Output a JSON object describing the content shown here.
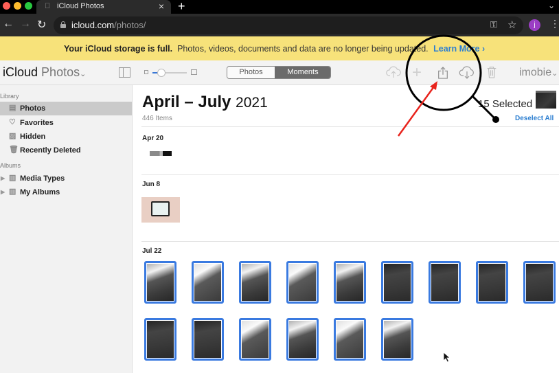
{
  "browser": {
    "tab_title": "iCloud Photos",
    "new_tab_label": "+",
    "url_host": "icloud.com",
    "url_path": "/photos/",
    "profile_initial": "j"
  },
  "banner": {
    "bold_text": "Your iCloud storage is full.",
    "text": "Photos, videos, documents and data are no longer being updated.",
    "link_label": "Learn More",
    "link_chevron": "›"
  },
  "toolbar": {
    "app_name": "iCloud",
    "app_section": "Photos",
    "app_chevron": "⌄",
    "zoom_level": 0.25,
    "segments": [
      "Photos",
      "Moments"
    ],
    "active_segment": "Moments",
    "account_name": "imobie",
    "account_chevron": "⌄"
  },
  "sidebar": {
    "library_header": "Library",
    "library_items": [
      {
        "label": "Photos",
        "icon": "photos-icon",
        "active": true
      },
      {
        "label": "Favorites",
        "icon": "heart-icon",
        "active": false
      },
      {
        "label": "Hidden",
        "icon": "hidden-icon",
        "active": false
      },
      {
        "label": "Recently Deleted",
        "icon": "trash-icon",
        "active": false
      }
    ],
    "albums_header": "Albums",
    "album_items": [
      {
        "label": "Media Types",
        "icon": "album-icon"
      },
      {
        "label": "My Albums",
        "icon": "album-icon"
      }
    ]
  },
  "main": {
    "title_bold": "April – July",
    "title_year": "2021",
    "item_count": "446 Items",
    "selection_text": "15 Selected",
    "deselect_label": "Deselect All",
    "groups": [
      {
        "date": "Apr 20",
        "photos": 1
      },
      {
        "date": "Jun 8",
        "photos": 1
      },
      {
        "date": "Jul 22",
        "photos": 15,
        "selected": 15
      }
    ]
  },
  "annotations": {
    "magnifier_color": "#000000",
    "arrow_color": "#e8231c"
  }
}
